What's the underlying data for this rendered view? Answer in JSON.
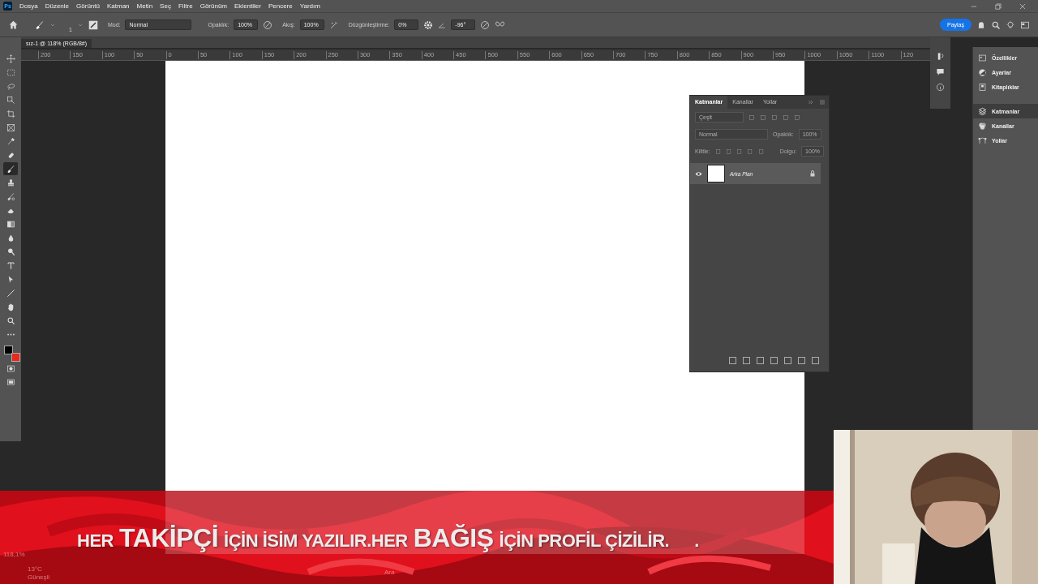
{
  "app": {
    "logo": "Ps"
  },
  "menu": [
    "Dosya",
    "Düzenle",
    "Görüntü",
    "Katman",
    "Metin",
    "Seç",
    "Filtre",
    "Görünüm",
    "Eklentiler",
    "Pencere",
    "Yardım"
  ],
  "options_bar": {
    "brush_size": "1",
    "mode_label": "Mod:",
    "mode": "Normal",
    "opacity_label": "Opaklık:",
    "opacity": "100%",
    "flow_label": "Akış:",
    "flow": "100%",
    "smoothing_label": "Düzgünleştirme:",
    "smoothing": "0%",
    "angle": "-96°",
    "share_button": "Paylaş"
  },
  "document_tab": {
    "title": "sız-1 @ 118% (RGB/8#)"
  },
  "ruler": [
    "200",
    "150",
    "100",
    "50",
    "0",
    "50",
    "100",
    "150",
    "200",
    "250",
    "300",
    "350",
    "400",
    "450",
    "500",
    "550",
    "600",
    "650",
    "700",
    "750",
    "800",
    "850",
    "900",
    "950",
    "1000",
    "1050",
    "1100",
    "120"
  ],
  "toolbar": [
    {
      "kind": "move",
      "selected": false
    },
    {
      "kind": "marquee",
      "selected": false
    },
    {
      "kind": "lasso",
      "selected": false
    },
    {
      "kind": "select",
      "selected": false
    },
    {
      "kind": "crop",
      "selected": false
    },
    {
      "kind": "frame",
      "selected": false
    },
    {
      "kind": "eyedropper",
      "selected": false
    },
    {
      "kind": "heal",
      "selected": false
    },
    {
      "kind": "brush",
      "selected": true
    },
    {
      "kind": "stamp",
      "selected": false
    },
    {
      "kind": "history",
      "selected": false
    },
    {
      "kind": "eraser",
      "selected": false
    },
    {
      "kind": "gradient",
      "selected": false
    },
    {
      "kind": "blur",
      "selected": false
    },
    {
      "kind": "dodge",
      "selected": false
    },
    {
      "kind": "type",
      "selected": false
    },
    {
      "kind": "path",
      "selected": false
    },
    {
      "kind": "line",
      "selected": false
    },
    {
      "kind": "hand",
      "selected": false
    },
    {
      "kind": "zoom",
      "selected": false
    },
    {
      "kind": "more",
      "selected": false
    }
  ],
  "color_swatches": [
    {
      "color": "#000000"
    },
    {
      "color": "#e8291c"
    }
  ],
  "layers_panel": {
    "tabs": [
      {
        "label": "Katmanlar",
        "selected": true
      },
      {
        "label": "Kanallar",
        "selected": false
      },
      {
        "label": "Yollar",
        "selected": false
      }
    ],
    "filter": "Çeşit",
    "blend_mode": "Normal",
    "opacity_label": "Opaklık:",
    "opacity": "100%",
    "lock_label": "Kilitle:",
    "fill_label": "Dolgu:",
    "fill": "100%",
    "layers": [
      {
        "name": "Arka Plan",
        "visible": true,
        "locked": true,
        "selected": true
      }
    ]
  },
  "dock": [
    {
      "label": "Özellikler",
      "kind": "properties",
      "selected": false
    },
    {
      "label": "Ayarlar",
      "kind": "adjust",
      "selected": false
    },
    {
      "label": "Kitaplıklar",
      "kind": "library",
      "selected": false
    },
    {
      "label": "Katmanlar",
      "kind": "layers",
      "selected": true
    },
    {
      "label": "Kanallar",
      "kind": "channels",
      "selected": false
    },
    {
      "label": "Yollar",
      "kind": "paths",
      "selected": false
    }
  ],
  "banner": {
    "segments": [
      {
        "text": "HER",
        "big": false
      },
      {
        "text": "TAKİPÇİ",
        "big": true
      },
      {
        "text": "İÇİN İSİM YAZILIR.HER",
        "big": false
      },
      {
        "text": "BAĞIŞ",
        "big": true
      },
      {
        "text": "İÇİN PROFİL ÇİZİLİR.",
        "big": false
      },
      {
        "text": ".",
        "big": false
      }
    ]
  },
  "underlay": {
    "zoom": "118,1%",
    "temperature": "13°C",
    "weather": "Güneşli",
    "search": "Ara"
  }
}
